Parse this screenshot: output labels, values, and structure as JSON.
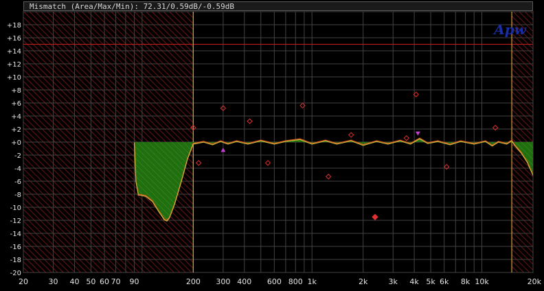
{
  "title": "Mismatch (Area/Max/Min): 72.31/0.59dB/-0.59dB",
  "logo": "Apw",
  "colors": {
    "background": "#000000",
    "grid": "#444444",
    "hatch": "#8a1a1a",
    "limit_line": "#c81e1e",
    "band_edge": "#e8a020",
    "fill_green": "#1f6e10",
    "curve_yellow": "#c8c840",
    "curve_red": "#d85a20",
    "marker_red": "#e03030",
    "marker_magenta": "#c040d0",
    "logo": "#1a2ea8"
  },
  "chart_data": {
    "type": "area",
    "x_scale": "log",
    "xlim": [
      20,
      20000
    ],
    "ylim": [
      -20,
      20
    ],
    "grid": true,
    "x_tick_labels": [
      {
        "v": 20,
        "t": "20"
      },
      {
        "v": 30,
        "t": "30"
      },
      {
        "v": 40,
        "t": "40"
      },
      {
        "v": 50,
        "t": "50"
      },
      {
        "v": 60,
        "t": "60"
      },
      {
        "v": 70,
        "t": "70"
      },
      {
        "v": 90,
        "t": "90"
      },
      {
        "v": 200,
        "t": "200"
      },
      {
        "v": 300,
        "t": "300"
      },
      {
        "v": 400,
        "t": "400"
      },
      {
        "v": 600,
        "t": "600"
      },
      {
        "v": 800,
        "t": "800"
      },
      {
        "v": 1000,
        "t": "1k"
      },
      {
        "v": 2000,
        "t": "2k"
      },
      {
        "v": 3000,
        "t": "3k"
      },
      {
        "v": 4000,
        "t": "4k"
      },
      {
        "v": 5000,
        "t": "5k"
      },
      {
        "v": 6000,
        "t": "6k"
      },
      {
        "v": 8000,
        "t": "8k"
      },
      {
        "v": 10000,
        "t": "10k"
      },
      {
        "v": 20000,
        "t": "20k"
      }
    ],
    "y_tick_labels": [
      "+18",
      "+16",
      "+14",
      "+12",
      "+10",
      "+8",
      "+6",
      "+4",
      "+2",
      "+0",
      "-2",
      "-4",
      "-6",
      "-8",
      "-10",
      "-12",
      "-14",
      "-16",
      "-18",
      "-20"
    ],
    "excluded_bands": [
      [
        20,
        90
      ],
      [
        90,
        200
      ],
      [
        15000,
        20000
      ]
    ],
    "band_edges": [
      200,
      15000
    ],
    "limit_line_db": 15,
    "mismatch_curve": [
      [
        90,
        0
      ],
      [
        92,
        -6
      ],
      [
        95,
        -8
      ],
      [
        105,
        -8.2
      ],
      [
        115,
        -9
      ],
      [
        125,
        -10.5
      ],
      [
        135,
        -11.8
      ],
      [
        140,
        -12
      ],
      [
        145,
        -11.5
      ],
      [
        155,
        -9.5
      ],
      [
        170,
        -6
      ],
      [
        185,
        -2.5
      ],
      [
        200,
        -0.2
      ],
      [
        230,
        0.1
      ],
      [
        260,
        -0.3
      ],
      [
        290,
        0.2
      ],
      [
        320,
        -0.2
      ],
      [
        360,
        0.2
      ],
      [
        420,
        -0.2
      ],
      [
        500,
        0.3
      ],
      [
        600,
        -0.2
      ],
      [
        700,
        0.2
      ],
      [
        850,
        0.5
      ],
      [
        1000,
        -0.2
      ],
      [
        1200,
        0.3
      ],
      [
        1400,
        -0.2
      ],
      [
        1700,
        0.3
      ],
      [
        2000,
        -0.4
      ],
      [
        2400,
        0.2
      ],
      [
        2800,
        -0.2
      ],
      [
        3300,
        0.3
      ],
      [
        3800,
        -0.2
      ],
      [
        4300,
        0.6
      ],
      [
        4800,
        -0.1
      ],
      [
        5500,
        0.2
      ],
      [
        6500,
        -0.3
      ],
      [
        7500,
        0.2
      ],
      [
        9000,
        -0.2
      ],
      [
        10500,
        0.2
      ],
      [
        11500,
        -0.5
      ],
      [
        12500,
        0.1
      ],
      [
        14000,
        -0.2
      ],
      [
        15000,
        0.3
      ],
      [
        15500,
        -0.3
      ],
      [
        17000,
        -1.5
      ],
      [
        18500,
        -3
      ],
      [
        20000,
        -5
      ]
    ],
    "markers_open_red": [
      [
        200,
        2.2
      ],
      [
        215,
        -3.2
      ],
      [
        300,
        5.2
      ],
      [
        430,
        3.2
      ],
      [
        550,
        -3.2
      ],
      [
        880,
        5.6
      ],
      [
        1250,
        -5.3
      ],
      [
        1700,
        1.1
      ],
      [
        3600,
        0.6
      ],
      [
        4100,
        7.3
      ],
      [
        6200,
        -3.8
      ],
      [
        12000,
        2.2
      ]
    ],
    "markers_filled_red": [
      [
        2350,
        -11.5
      ]
    ],
    "markers_magenta_up": [
      [
        300,
        -1.2
      ]
    ],
    "markers_magenta_down": [
      [
        4200,
        1.3
      ]
    ]
  }
}
